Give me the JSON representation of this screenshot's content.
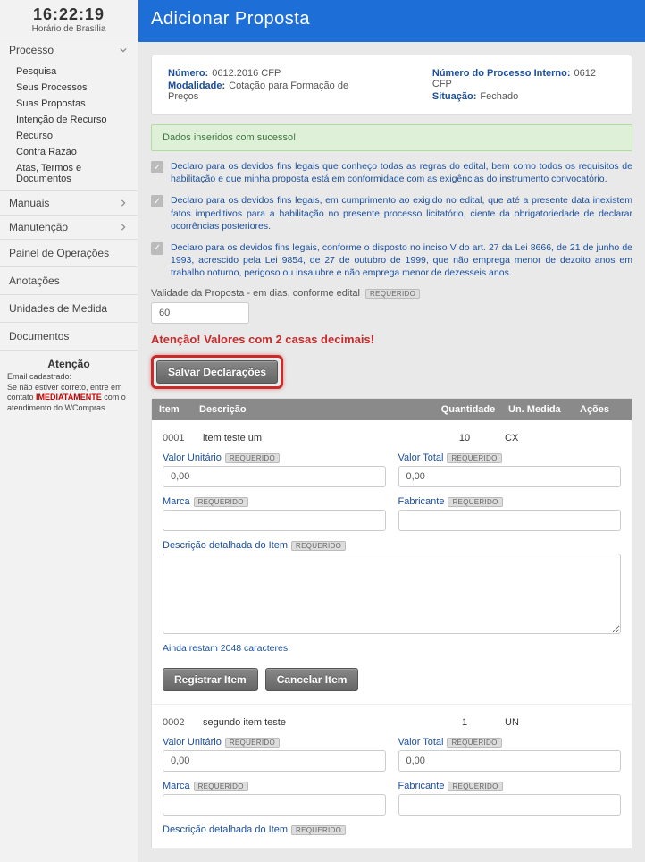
{
  "clock": {
    "time": "16:22:19",
    "label": "Horário de Brasília"
  },
  "sidebar": {
    "processo": {
      "title": "Processo",
      "items": [
        "Pesquisa",
        "Seus Processos",
        "Suas Propostas",
        "Intenção de Recurso",
        "Recurso",
        "Contra Razão",
        "Atas, Termos e Documentos"
      ]
    },
    "manuais": "Manuais",
    "manutencao": "Manutenção",
    "painel": "Painel de Operações",
    "anotacoes": "Anotações",
    "unidades": "Unidades de Medida",
    "documentos": "Documentos",
    "attention": {
      "title": "Atenção",
      "email_label": "Email cadastrado:",
      "note_before": "Se não estiver correto, entre em contato ",
      "note_highlight": "IMEDIATAMENTE",
      "note_after": " com o atendimento do WCompras."
    }
  },
  "page": {
    "title": "Adicionar Proposta",
    "info": {
      "numero_label": "Número:",
      "numero": "0612.2016 CFP",
      "modalidade_label": "Modalidade:",
      "modalidade": "Cotação para Formação de Preços",
      "processo_interno_label": "Número do Processo Interno:",
      "processo_interno": "0612 CFP",
      "situacao_label": "Situação:",
      "situacao": "Fechado"
    },
    "success": "Dados inseridos com sucesso!",
    "declarations": [
      "Declaro para os devidos fins legais que conheço todas as regras do edital, bem como todos os requisitos de habilitação e que minha proposta está em conformidade com as exigências do instrumento convocatório.",
      "Declaro para os devidos fins legais, em cumprimento ao exigido no edital, que até a presente data inexistem fatos impeditivos para a habilitação no presente processo licitatório, ciente da obrigatoriedade de declarar ocorrências posteriores.",
      "Declaro para os devidos fins legais, conforme o disposto no inciso V do art. 27 da Lei 8666, de 21 de junho de 1993, acrescido pela Lei 9854, de 27 de outubro de 1999, que não emprega menor de dezoito anos em trabalho noturno, perigoso ou insalubre e não emprega menor de dezesseis anos."
    ],
    "validity_label": "Validade da Proposta - em dias, conforme edital",
    "validity_value": "60",
    "required_badge": "REQUERIDO",
    "warning": "Atenção! Valores com 2 casas decimais!",
    "save_btn": "Salvar Declarações",
    "table": {
      "headers": {
        "item": "Item",
        "desc": "Descrição",
        "qty": "Quantidade",
        "un": "Un. Medida",
        "ac": "Ações"
      },
      "labels": {
        "valor_unit": "Valor Unitário",
        "valor_total": "Valor Total",
        "marca": "Marca",
        "fabricante": "Fabricante",
        "desc_det": "Descrição detalhada do Item",
        "chars_left": "Ainda restam 2048 caracteres.",
        "registrar": "Registrar Item",
        "cancelar": "Cancelar Item"
      },
      "items": [
        {
          "num": "0001",
          "desc": "item teste um",
          "qty": "10",
          "un": "CX",
          "valor_unit": "0,00",
          "valor_total": "0,00",
          "marca": "",
          "fabricante": "",
          "detalhe": ""
        },
        {
          "num": "0002",
          "desc": "segundo item teste",
          "qty": "1",
          "un": "UN",
          "valor_unit": "0,00",
          "valor_total": "0,00",
          "marca": "",
          "fabricante": "",
          "detalhe": ""
        }
      ]
    }
  }
}
